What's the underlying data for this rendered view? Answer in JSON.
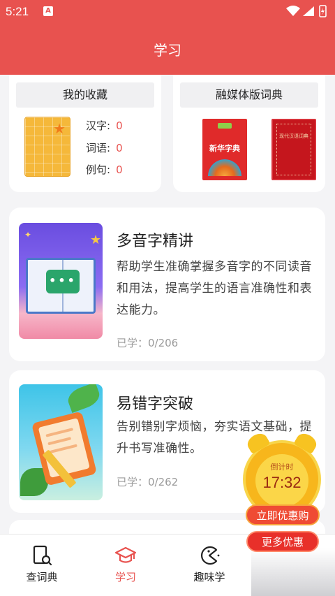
{
  "status_bar": {
    "time": "5:21",
    "notification_letter": "A"
  },
  "header": {
    "title": "学习"
  },
  "favorites": {
    "title": "我的收藏",
    "rows": [
      {
        "label": "汉字:",
        "count": "0"
      },
      {
        "label": "词语:",
        "count": "0"
      },
      {
        "label": "例句:",
        "count": "0"
      }
    ]
  },
  "dictionaries": {
    "title": "融媒体版词典",
    "book1_title": "新华字典",
    "book2_title": "现代汉语词典"
  },
  "features": [
    {
      "title": "多音字精讲",
      "description": "帮助学生准确掌握多音字的不同读音和用法，提高学生的语言准确性和表达能力。",
      "progress": "已学：0/206"
    },
    {
      "title": "易错字突破",
      "description": "告别错别字烦恼，夯实语文基础，提升书写准确性。",
      "progress": "已学：0/262"
    }
  ],
  "promo": {
    "countdown_label": "倒计时",
    "countdown_time": "17:32",
    "buy_label": "立即优惠购",
    "more_label": "更多优惠"
  },
  "bottom_nav": {
    "items": [
      {
        "label": "查词典",
        "icon": "dictionary-search-icon"
      },
      {
        "label": "学习",
        "icon": "graduation-cap-icon",
        "active": true
      },
      {
        "label": "趣味学",
        "icon": "game-icon"
      }
    ]
  },
  "colors": {
    "primary": "#e8524f",
    "count": "#e8524f",
    "progress": "#9a9a9a"
  }
}
